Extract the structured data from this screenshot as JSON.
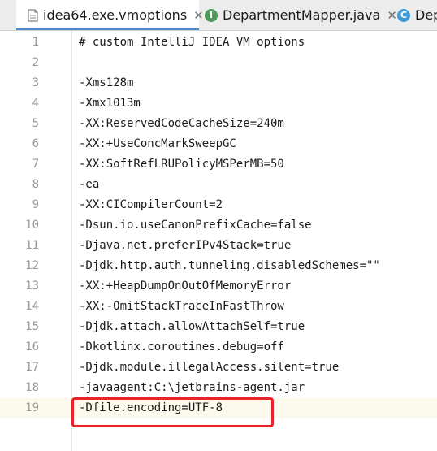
{
  "tabs": [
    {
      "label": "idea64.exe.vmoptions",
      "icon": "settings-file-icon",
      "active": true
    },
    {
      "label": "DepartmentMapper.java",
      "icon": "interface-icon",
      "icon_letter": "I",
      "icon_color": "#4e9a5a",
      "active": false
    },
    {
      "label": "Dep",
      "icon": "class-icon",
      "icon_letter": "C",
      "icon_color": "#3c9bd6",
      "active": false
    }
  ],
  "editor": {
    "lines": [
      {
        "number": "1",
        "text": "# custom IntelliJ IDEA VM options"
      },
      {
        "number": "2",
        "text": ""
      },
      {
        "number": "3",
        "text": "-Xms128m"
      },
      {
        "number": "4",
        "text": "-Xmx1013m"
      },
      {
        "number": "5",
        "text": "-XX:ReservedCodeCacheSize=240m"
      },
      {
        "number": "6",
        "text": "-XX:+UseConcMarkSweepGC"
      },
      {
        "number": "7",
        "text": "-XX:SoftRefLRUPolicyMSPerMB=50"
      },
      {
        "number": "8",
        "text": "-ea"
      },
      {
        "number": "9",
        "text": "-XX:CICompilerCount=2"
      },
      {
        "number": "10",
        "text": "-Dsun.io.useCanonPrefixCache=false"
      },
      {
        "number": "11",
        "text": "-Djava.net.preferIPv4Stack=true"
      },
      {
        "number": "12",
        "text": "-Djdk.http.auth.tunneling.disabledSchemes=\"\""
      },
      {
        "number": "13",
        "text": "-XX:+HeapDumpOnOutOfMemoryError"
      },
      {
        "number": "14",
        "text": "-XX:-OmitStackTraceInFastThrow"
      },
      {
        "number": "15",
        "text": "-Djdk.attach.allowAttachSelf=true"
      },
      {
        "number": "16",
        "text": "-Dkotlinx.coroutines.debug=off"
      },
      {
        "number": "17",
        "text": "-Djdk.module.illegalAccess.silent=true"
      },
      {
        "number": "18",
        "text": "-javaagent:C:\\jetbrains-agent.jar"
      },
      {
        "number": "19",
        "text": "-Dfile.encoding=UTF-8"
      }
    ],
    "current_line": "19",
    "highlight_color": "#e8232a"
  }
}
